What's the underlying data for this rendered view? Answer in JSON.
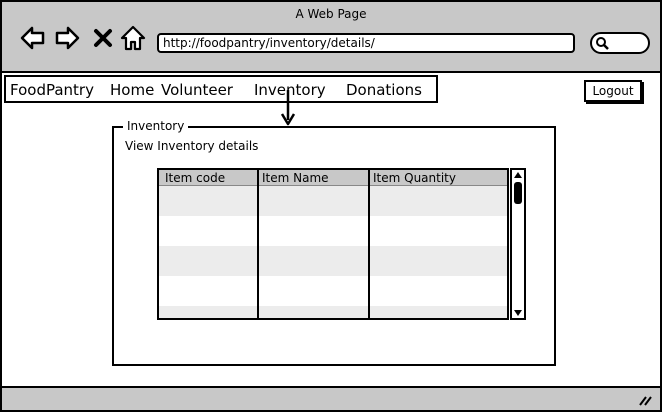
{
  "browser": {
    "window_title": "A Web Page",
    "url": "http://foodpantry/inventory/details/",
    "icons": [
      "back-icon",
      "forward-icon",
      "close-icon",
      "home-icon",
      "search-icon"
    ]
  },
  "nav": {
    "brand": "FoodPantry",
    "items": [
      "Home",
      "Volunteer",
      "Inventory",
      "Donations"
    ],
    "logout": "Logout"
  },
  "inventory": {
    "group_title": "Inventory",
    "subtitle": "View Inventory details",
    "columns": [
      "Item code",
      "Item Name",
      "Item Quantity"
    ],
    "rows": [
      [
        "",
        "",
        ""
      ],
      [
        "",
        "",
        ""
      ],
      [
        "",
        "",
        ""
      ],
      [
        "",
        "",
        ""
      ],
      [
        "",
        "",
        ""
      ]
    ]
  }
}
